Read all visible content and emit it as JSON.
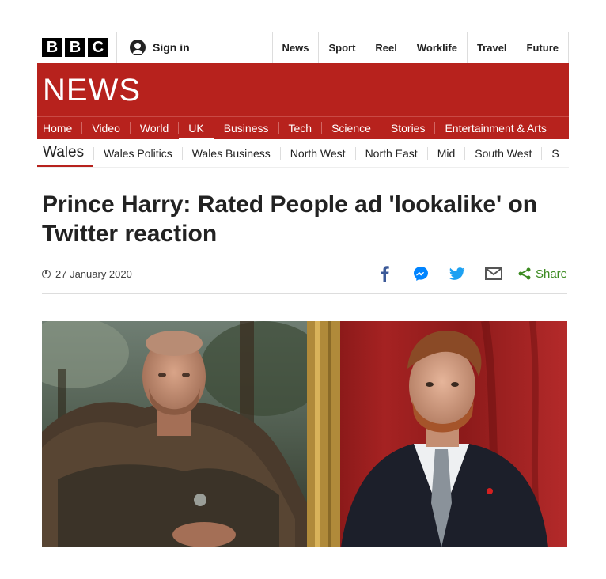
{
  "brand": {
    "logo_letters": [
      "B",
      "B",
      "C"
    ],
    "sign_in_label": "Sign in"
  },
  "top_nav": [
    "News",
    "Sport",
    "Reel",
    "Worklife",
    "Travel",
    "Future"
  ],
  "news_band": {
    "title": "NEWS",
    "nav": [
      "Home",
      "Video",
      "World",
      "UK",
      "Business",
      "Tech",
      "Science",
      "Stories",
      "Entertainment & Arts"
    ],
    "active": "UK"
  },
  "sub_nav": {
    "section": "Wales",
    "items": [
      "Wales Politics",
      "Wales Business",
      "North West",
      "North East",
      "Mid",
      "South West",
      "S"
    ]
  },
  "article": {
    "headline": "Prince Harry: Rated People ad 'lookalike' on Twitter reaction",
    "date": "27 January 2020",
    "share_label": "Share"
  },
  "colors": {
    "brand_red": "#b7221d",
    "share_green": "#3a8a1f",
    "facebook_blue": "#3b5998",
    "messenger_blue": "#0084ff",
    "twitter_blue": "#1da1f2"
  },
  "icons": [
    "user-icon",
    "clock-icon",
    "facebook-icon",
    "messenger-icon",
    "twitter-icon",
    "email-icon",
    "share-icon"
  ]
}
